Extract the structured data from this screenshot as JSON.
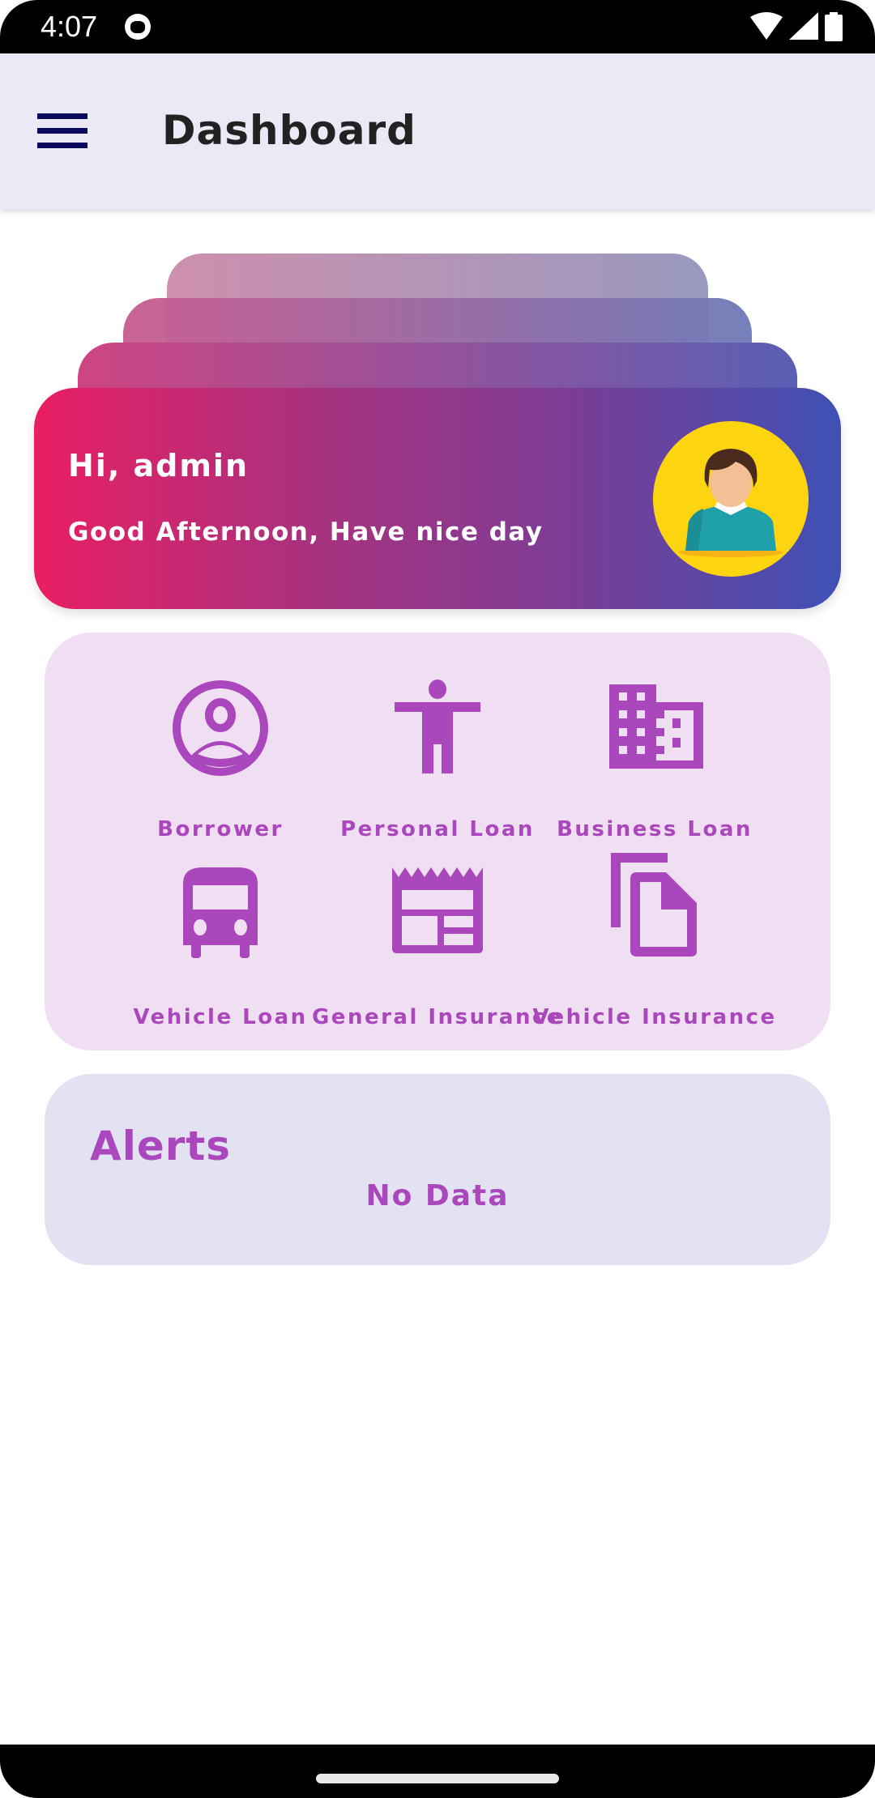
{
  "status_bar": {
    "time": "4:07",
    "icons": [
      "cat-notification-icon",
      "wifi-icon",
      "signal-icon",
      "battery-icon"
    ]
  },
  "app_bar": {
    "menu_icon": "hamburger-menu-icon",
    "title": "Dashboard"
  },
  "welcome_card": {
    "greeting": "Hi, admin",
    "message": "Good Afternoon, Have nice day",
    "avatar_icon": "user-avatar-icon",
    "gradient": [
      "#e91e63",
      "#3f51b5"
    ]
  },
  "services": {
    "accent_color": "#ab47bc",
    "items": [
      {
        "label": "Borrower",
        "icon": "account-circle-icon"
      },
      {
        "label": "Personal Loan",
        "icon": "accessibility-person-icon"
      },
      {
        "label": "Business Loan",
        "icon": "building-icon"
      },
      {
        "label": "Vehicle Loan",
        "icon": "bus-icon"
      },
      {
        "label": "General Insurance",
        "icon": "receipt-newspaper-icon"
      },
      {
        "label": "Vehicle Insurance",
        "icon": "copy-document-icon"
      }
    ]
  },
  "alerts": {
    "title": "Alerts",
    "empty_text": "No Data"
  }
}
